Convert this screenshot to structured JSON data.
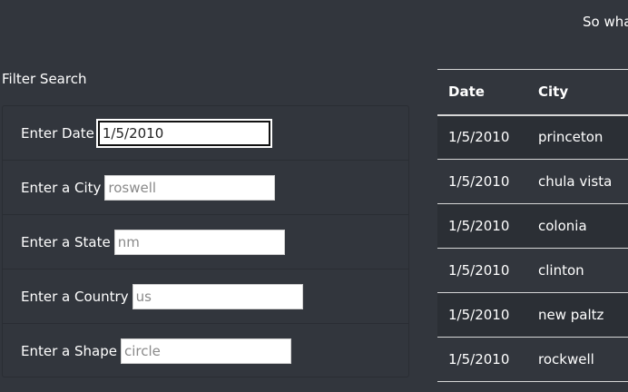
{
  "intro": {
    "text": "So wha see."
  },
  "filter": {
    "title": "Filter Search",
    "fields": [
      {
        "label": "Enter Date",
        "value": "1/5/2010",
        "placeholder": "",
        "name": "date"
      },
      {
        "label": "Enter a City",
        "value": "",
        "placeholder": "roswell",
        "name": "city"
      },
      {
        "label": "Enter a State",
        "value": "",
        "placeholder": "nm",
        "name": "state"
      },
      {
        "label": "Enter a Country",
        "value": "",
        "placeholder": "us",
        "name": "country"
      },
      {
        "label": "Enter a Shape",
        "value": "",
        "placeholder": "circle",
        "name": "shape"
      }
    ]
  },
  "table": {
    "headers": [
      "Date",
      "City"
    ],
    "rows": [
      [
        "1/5/2010",
        "princeton"
      ],
      [
        "1/5/2010",
        "chula vista"
      ],
      [
        "1/5/2010",
        "colonia"
      ],
      [
        "1/5/2010",
        "clinton"
      ],
      [
        "1/5/2010",
        "new paltz"
      ],
      [
        "1/5/2010",
        "rockwell"
      ]
    ]
  },
  "colors": {
    "background": "#32363d",
    "row_stripe": "#2b2f35",
    "text": "#ffffff",
    "table_border": "#d6d6d6"
  }
}
